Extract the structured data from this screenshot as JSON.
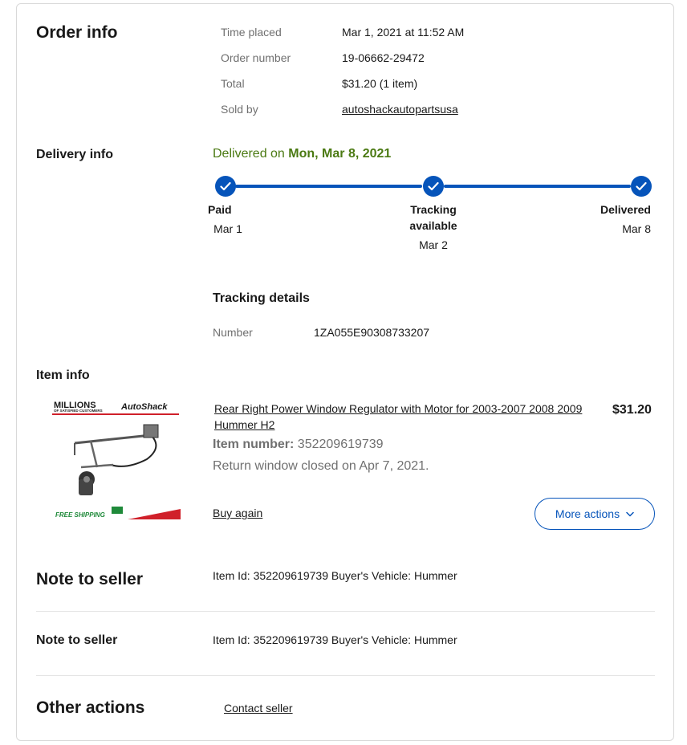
{
  "order_info": {
    "heading": "Order info",
    "rows": [
      {
        "label": "Time placed",
        "value": "Mar 1, 2021 at 11:52 AM"
      },
      {
        "label": "Order number",
        "value": "19-06662-29472"
      },
      {
        "label": "Total",
        "value": "$31.20 (1 item)"
      },
      {
        "label": "Sold by",
        "value": "autoshackautopartsusa"
      }
    ]
  },
  "delivery_info": {
    "heading": "Delivery info",
    "status_prefix": "Delivered on",
    "status_date": "Mon, Mar 8, 2021",
    "steps": [
      {
        "title": "Paid",
        "date": "Mar 1"
      },
      {
        "title": "Tracking available",
        "date": "Mar 2"
      },
      {
        "title": "Delivered",
        "date": "Mar 8"
      }
    ],
    "tracking_heading": "Tracking details",
    "tracking_label": "Number",
    "tracking_number": "1ZA055E90308733207"
  },
  "item_info": {
    "heading": "Item info",
    "image_banner_top_left": "MILLIONS",
    "image_banner_top_sub": "OF SATISFIED CUSTOMERS",
    "image_banner_top_right": "AutoShack",
    "image_banner_bottom": "FREE SHIPPING",
    "title": "Rear Right Power Window Regulator with Motor for 2003-2007 2008 2009 Hummer H2",
    "item_number_label": "Item number:",
    "item_number": "352209619739",
    "return_text": "Return window closed on Apr 7, 2021.",
    "price": "$31.20",
    "buy_again": "Buy again",
    "more_actions": "More actions"
  },
  "note_to_seller_1": {
    "heading": "Note to seller",
    "text": "Item Id: 352209619739 Buyer's Vehicle: Hummer"
  },
  "note_to_seller_2": {
    "heading": "Note to seller",
    "text": "Item Id: 352209619739 Buyer's Vehicle: Hummer"
  },
  "other_actions": {
    "heading": "Other actions",
    "contact_seller": "Contact seller"
  },
  "colors": {
    "accent": "#0654ba",
    "delivered_green": "#4b7a13",
    "muted": "#707070"
  }
}
